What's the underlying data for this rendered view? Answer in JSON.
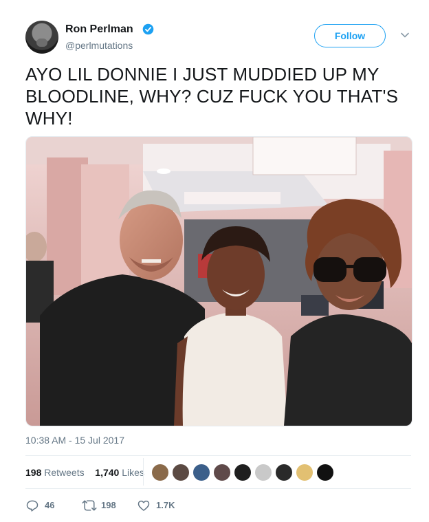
{
  "user": {
    "display_name": "Ron Perlman",
    "handle": "@perlmutations",
    "verified": true,
    "avatar_icon": "user-avatar"
  },
  "follow_label": "Follow",
  "tweet": {
    "text": "AYO LIL DONNIE I JUST MUDDIED UP MY BLOODLINE, WHY? CUZ FUCK YOU THAT'S WHY!",
    "timestamp": "10:38 AM - 15 Jul 2017"
  },
  "stats": {
    "retweets_count": "198",
    "retweets_label": "Retweets",
    "likes_count": "1,740",
    "likes_label": "Likes"
  },
  "actions": {
    "reply_count": "46",
    "retweet_count": "198",
    "like_count": "1.7K"
  },
  "colors": {
    "accent": "#1da1f2",
    "secondary_text": "#657786",
    "divider": "#e6ecf0"
  }
}
